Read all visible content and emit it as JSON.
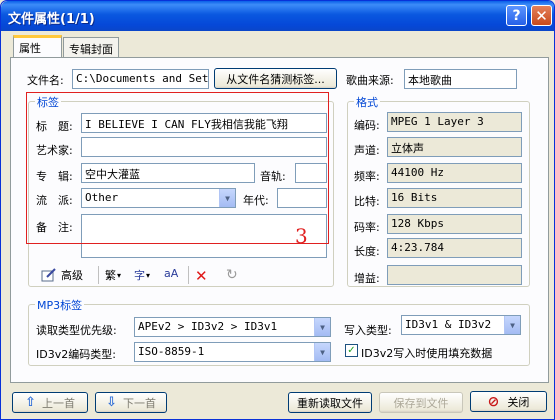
{
  "window": {
    "title": "文件属性(1/1)",
    "help": "?",
    "close": "✕"
  },
  "tabs": [
    "属性",
    "专辑封面"
  ],
  "file": {
    "label": "文件名:",
    "value": "C:\\Documents and Setti",
    "guess_button": "从文件名猜测标签...",
    "source_label": "歌曲来源:",
    "source_value": "本地歌曲"
  },
  "tag_group": {
    "title": "标签",
    "title_label": "标　题:",
    "title_value": "I BELIEVE I CAN FLY我相信我能飞翔",
    "artist_label": "艺术家:",
    "artist_value": "",
    "album_label": "专　辑:",
    "album_value": "空中大灌蓝",
    "track_label": "音轨:",
    "track_value": "",
    "genre_label": "流　派:",
    "genre_value": "Other",
    "year_label": "年代:",
    "year_value": "",
    "comment_label": "备　注:",
    "comment_value": ""
  },
  "annotation": "3",
  "toolbar": {
    "advanced": "高级",
    "trad": "繁",
    "spell": "字",
    "case": "aA"
  },
  "format_group": {
    "title": "格式",
    "codec_label": "编码:",
    "codec_value": "MPEG 1 Layer 3",
    "channel_label": "声道:",
    "channel_value": "立体声",
    "freq_label": "频率:",
    "freq_value": "44100 Hz",
    "bits_label": "比特:",
    "bits_value": "16 Bits",
    "bitrate_label": "码率:",
    "bitrate_value": "128 Kbps",
    "length_label": "长度:",
    "length_value": "4:23.784",
    "gain_label": "增益:",
    "gain_value": ""
  },
  "mp3_group": {
    "title": "MP3标签",
    "read_label": "读取类型优先级:",
    "read_value": "APEv2 > ID3v2 > ID3v1",
    "write_label": "写入类型:",
    "write_value": "ID3v1 & ID3v2",
    "encoding_label": "ID3v2编码类型:",
    "encoding_value": "ISO-8859-1",
    "padding_label": "ID3v2写入时使用填充数据",
    "padding_checked": true
  },
  "bottom": {
    "prev": "上一首",
    "next": "下一首",
    "reread": "重新读取文件",
    "save": "保存到文件",
    "close": "关闭"
  }
}
